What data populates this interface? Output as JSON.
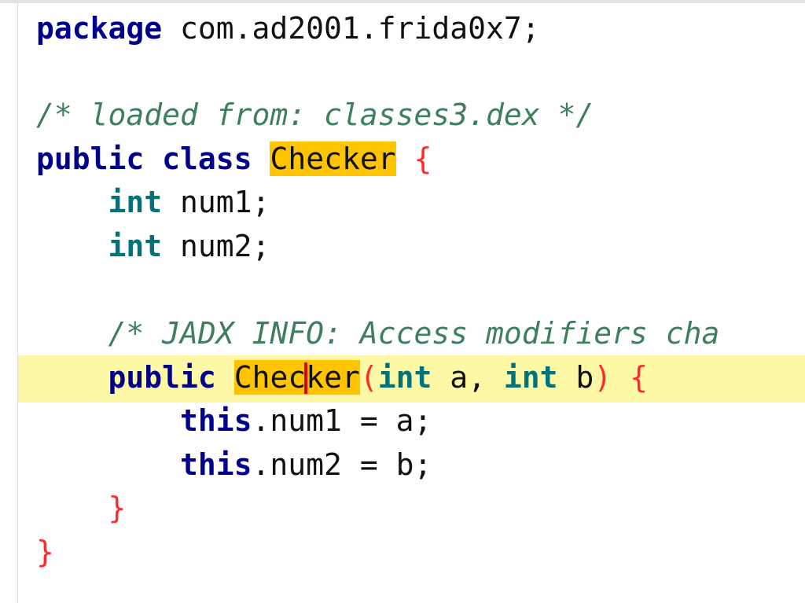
{
  "code": {
    "package_kw": "package",
    "package_name": " com.ad2001.frida0x7;",
    "comment1": "/* loaded from: classes3.dex */",
    "class_line": {
      "public": "public",
      "class": "class",
      "name": "Checker",
      "brace": "{"
    },
    "field1": {
      "type": "int",
      "name": " num1;"
    },
    "field2": {
      "type": "int",
      "name": " num2;"
    },
    "comment2": "/* JADX INFO: Access modifiers cha",
    "ctor": {
      "public": "public",
      "name_before_caret": "Chec",
      "name_after_caret": "ker",
      "lparen": "(",
      "int1": "int",
      "a": " a, ",
      "int2": "int",
      "b": " b",
      "rparen": ")",
      "brace": "{"
    },
    "assign1": {
      "this": "this",
      "rest": ".num1 = a;"
    },
    "assign2": {
      "this": "this",
      "rest": ".num2 = b;"
    },
    "close_inner": "}",
    "close_outer": "}"
  },
  "colors": {
    "keyword": "#00008b",
    "type": "#00727a",
    "comment": "#3f7f5f",
    "brace": "#ff2a2a",
    "highlight": "#ffc400",
    "current_line": "#fdf8a6"
  }
}
